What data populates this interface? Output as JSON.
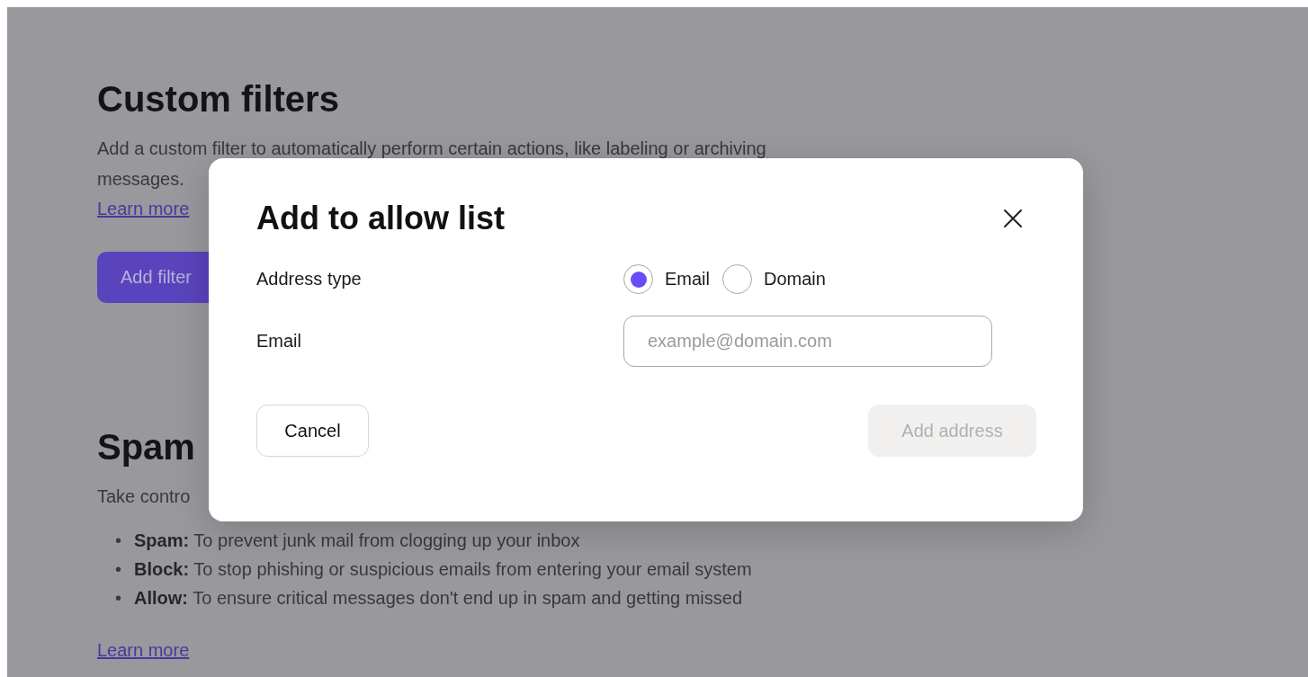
{
  "page": {
    "sections": [
      {
        "heading": "Custom filters",
        "description": "Add a custom filter to automatically perform certain actions, like labeling or archiving messages.",
        "link": "Learn more",
        "button": "Add filter"
      },
      {
        "heading": "Spam",
        "description": "Take contro",
        "bullets": [
          {
            "marker": "•",
            "term": "Spam:",
            "text": "To prevent junk mail from clogging up your inbox"
          },
          {
            "marker": "•",
            "term": "Block:",
            "text": "To stop phishing or suspicious emails from entering your email system"
          },
          {
            "marker": "•",
            "term": "Allow:",
            "text": "To ensure critical messages don't end up in spam and getting missed"
          }
        ],
        "link": "Learn more"
      }
    ]
  },
  "modal": {
    "title": "Add to allow list",
    "address_type": {
      "label": "Address type",
      "options": [
        {
          "label": "Email",
          "selected": true
        },
        {
          "label": "Domain",
          "selected": false
        }
      ]
    },
    "field": {
      "label": "Email",
      "placeholder": "example@domain.com"
    },
    "cancel": "Cancel",
    "submit": {
      "label": "Add address",
      "disabled": true
    }
  }
}
